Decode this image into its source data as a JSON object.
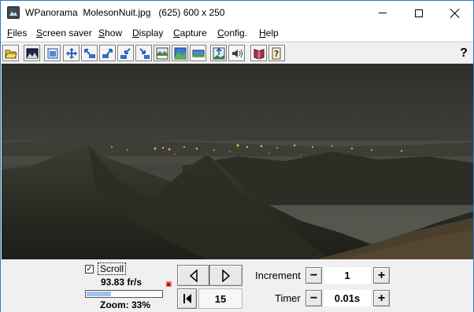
{
  "window": {
    "title": "WPanorama  MolesonNuit.jpg   (625) 600 x 250"
  },
  "menu": [
    {
      "label": "Files",
      "u": "F",
      "rest": "iles"
    },
    {
      "label": "Screen saver",
      "u": "S",
      "rest": "creen saver"
    },
    {
      "label": "Show",
      "u": "S",
      "rest": "how"
    },
    {
      "label": "Display",
      "u": "D",
      "rest": "isplay"
    },
    {
      "label": "Capture",
      "u": "C",
      "rest": "apture"
    },
    {
      "label": "Config.",
      "u": "C",
      "rest": "onfig."
    },
    {
      "label": "Help",
      "u": "H",
      "rest": "elp"
    }
  ],
  "toolbar": {
    "icons": [
      "open-folder-icon",
      "picture-icon",
      "fit-window-icon",
      "move-arrows-icon",
      "shrink-left-icon",
      "zoom-in-icon",
      "zoom-out-icon",
      "shrink-right-icon",
      "landscape-info-icon",
      "landscape-blue-icon",
      "landscape-flat-icon",
      "panorama-center-icon",
      "sound-icon",
      "book-icon",
      "help-file-icon"
    ],
    "help_label": "?"
  },
  "controls": {
    "scroll_checked": "✓",
    "scroll_label": "Scroll",
    "fps": "93.83 fr/s",
    "zoom": "Zoom: 33%",
    "zoom_fraction": 0.33,
    "frame_value": "15",
    "increment_label": "Increment",
    "increment_value": "1",
    "timer_label": "Timer",
    "timer_value": "0.01s",
    "minus": "−",
    "plus": "+"
  },
  "colors": {
    "accent": "#2b79c9",
    "progress_fill": "#9ec2ea",
    "night_sky": "#3a3c38",
    "city_lights": "#f0a030"
  }
}
